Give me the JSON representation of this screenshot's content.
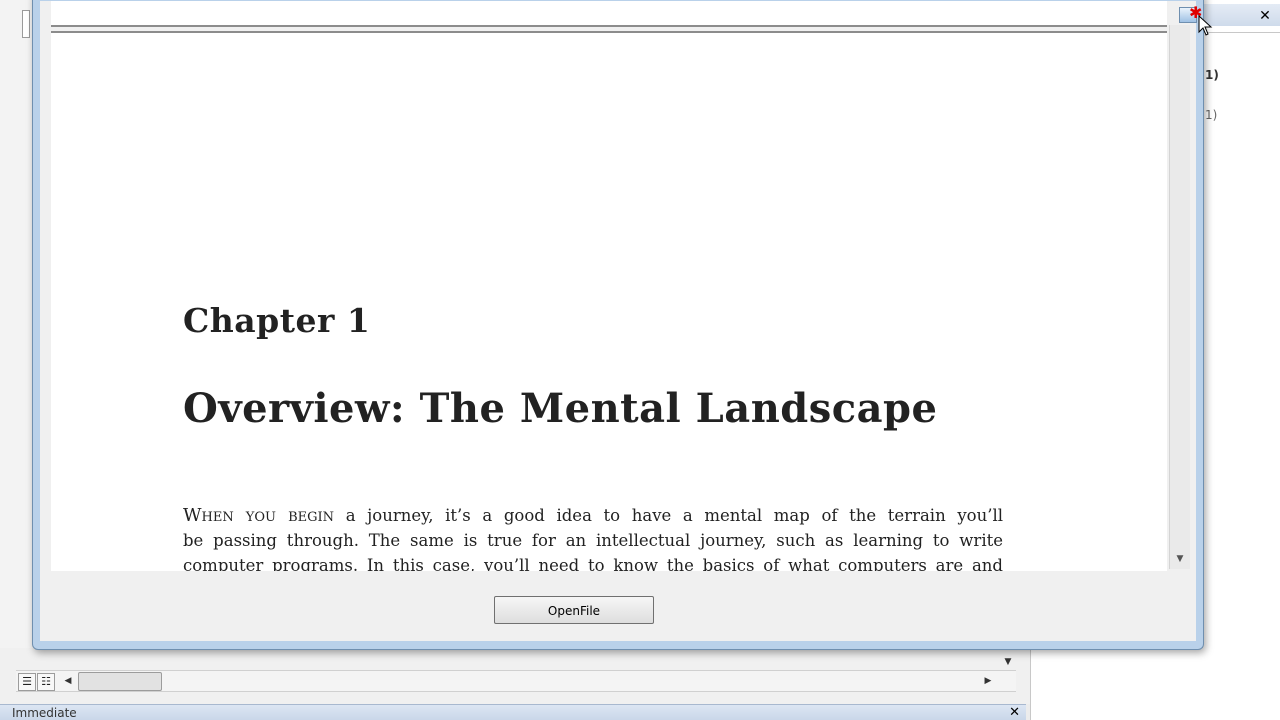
{
  "ide": {
    "right_panel": {
      "text_1": "1)",
      "text_2": "1)",
      "close_glyph": "✕"
    },
    "immediate": {
      "title": "Immediate",
      "close_glyph": "✕"
    },
    "hscroll": {
      "left_arrow": "◀",
      "right_arrow": "▶"
    },
    "code_vscroll_down": "▼",
    "view_buttons": [
      "☰",
      "☷"
    ]
  },
  "form": {
    "document": {
      "chapter_label": "Chapter 1",
      "chapter_title": "Overview: The Mental Landscape",
      "paragraph_lead": "When you begin",
      "paragraph_line_1_rest": " a journey, it’s a good idea to have a mental map of the terrain you’ll",
      "paragraph_line_2": "be passing through.  The same is true for an intellectual journey, such as learning to write",
      "paragraph_line_3": "computer programs.  In this case, you’ll need to know the basics of what computers are and"
    },
    "scroll_down_glyph": "▼",
    "open_file_button": "OpenFile",
    "corner_star": "✱"
  },
  "colors": {
    "window_frame": "#b9d1ea",
    "close_star": "#e00000",
    "page_text": "#222222"
  }
}
